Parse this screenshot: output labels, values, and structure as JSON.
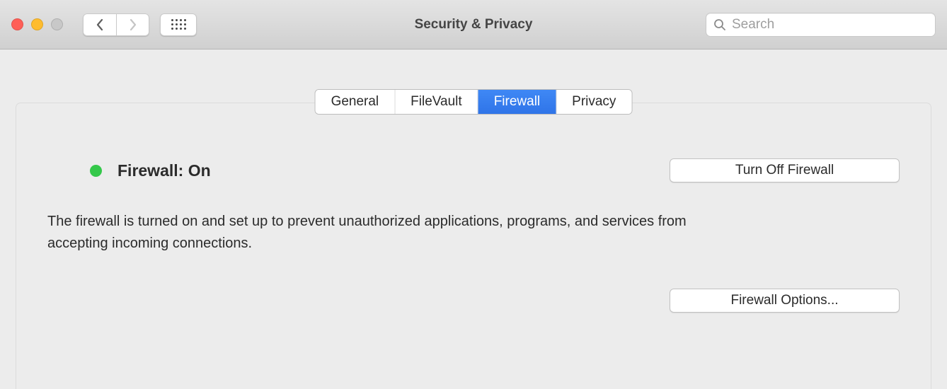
{
  "window": {
    "title": "Security & Privacy"
  },
  "search": {
    "placeholder": "Search"
  },
  "tabs": [
    {
      "label": "General",
      "active": false
    },
    {
      "label": "FileVault",
      "active": false
    },
    {
      "label": "Firewall",
      "active": true
    },
    {
      "label": "Privacy",
      "active": false
    }
  ],
  "firewall": {
    "status_label": "Firewall: On",
    "status_color": "#34c84a",
    "description": "The firewall is turned on and set up to prevent unauthorized applications, programs, and services from accepting incoming connections.",
    "turn_off_label": "Turn Off Firewall",
    "options_label": "Firewall Options..."
  }
}
